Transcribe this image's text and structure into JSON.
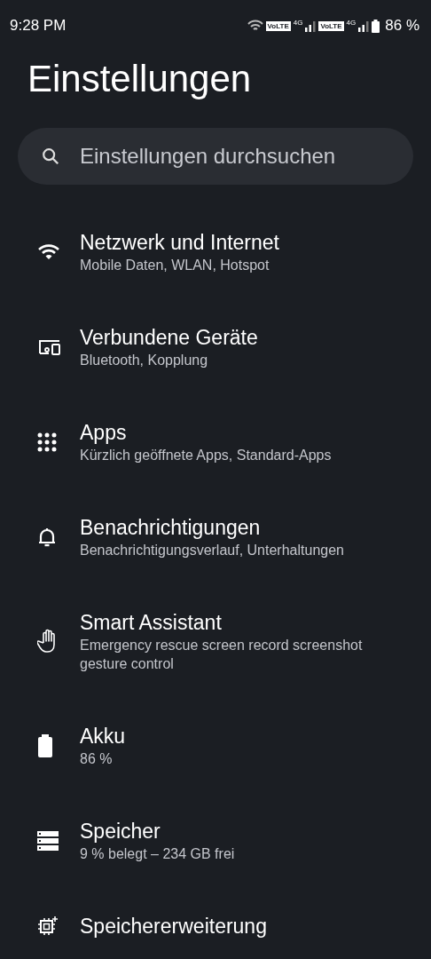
{
  "status_bar": {
    "time": "9:28 PM",
    "sim_labels": [
      {
        "volte": "VoLTE",
        "network": "4G"
      },
      {
        "volte": "VoLTE",
        "network": "4G"
      }
    ],
    "battery": "86 %"
  },
  "title": "Einstellungen",
  "search": {
    "placeholder": "Einstellungen durchsuchen"
  },
  "items": [
    {
      "kind": "wifi",
      "title": "Netzwerk und Internet",
      "subtitle": "Mobile Daten, WLAN, Hotspot"
    },
    {
      "kind": "devices",
      "title": "Verbundene Geräte",
      "subtitle": "Bluetooth, Kopplung"
    },
    {
      "kind": "apps",
      "title": "Apps",
      "subtitle": "Kürzlich geöffnete Apps, Standard-Apps"
    },
    {
      "kind": "bell",
      "title": "Benachrichtigungen",
      "subtitle": "Benachrichtigungsverlauf, Unterhaltungen"
    },
    {
      "kind": "hand",
      "title": "Smart Assistant",
      "subtitle": "Emergency rescue screen record screenshot gesture control"
    },
    {
      "kind": "battery",
      "title": "Akku",
      "subtitle": "86 %"
    },
    {
      "kind": "storage",
      "title": "Speicher",
      "subtitle": "9 % belegt – 234 GB frei"
    },
    {
      "kind": "chip",
      "title": "Speichererweiterung"
    }
  ]
}
